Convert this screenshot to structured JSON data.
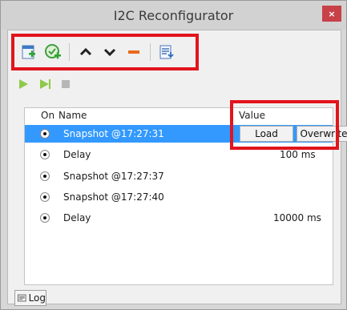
{
  "window": {
    "title": "I2C Reconfigurator",
    "close_glyph": "×"
  },
  "toolbar": {
    "buttons": [
      {
        "icon": "add-item-icon"
      },
      {
        "icon": "add-snapshot-icon"
      },
      {
        "icon": "move-up-icon"
      },
      {
        "icon": "move-down-icon"
      },
      {
        "icon": "remove-icon"
      },
      {
        "icon": "export-icon"
      }
    ]
  },
  "playbar": {
    "buttons": [
      {
        "icon": "play-icon"
      },
      {
        "icon": "play-all-icon"
      },
      {
        "icon": "stop-icon"
      }
    ]
  },
  "table": {
    "columns": {
      "on": "On",
      "name": "Name",
      "value": "Value"
    },
    "rows": [
      {
        "name": "Snapshot @17:27:31",
        "value": "",
        "load_label": "Load",
        "overwrite_label": "Overwrite",
        "selected": true
      },
      {
        "name": "Delay",
        "value": "100 ms"
      },
      {
        "name": "Snapshot @17:27:37",
        "value": ""
      },
      {
        "name": "Snapshot @17:27:40",
        "value": ""
      },
      {
        "name": "Delay",
        "value": "10000 ms"
      }
    ]
  },
  "footer": {
    "log_tab": "Log"
  },
  "colors": {
    "selection": "#3399ff",
    "highlight_frame": "#e2141c",
    "close": "#c84148"
  }
}
